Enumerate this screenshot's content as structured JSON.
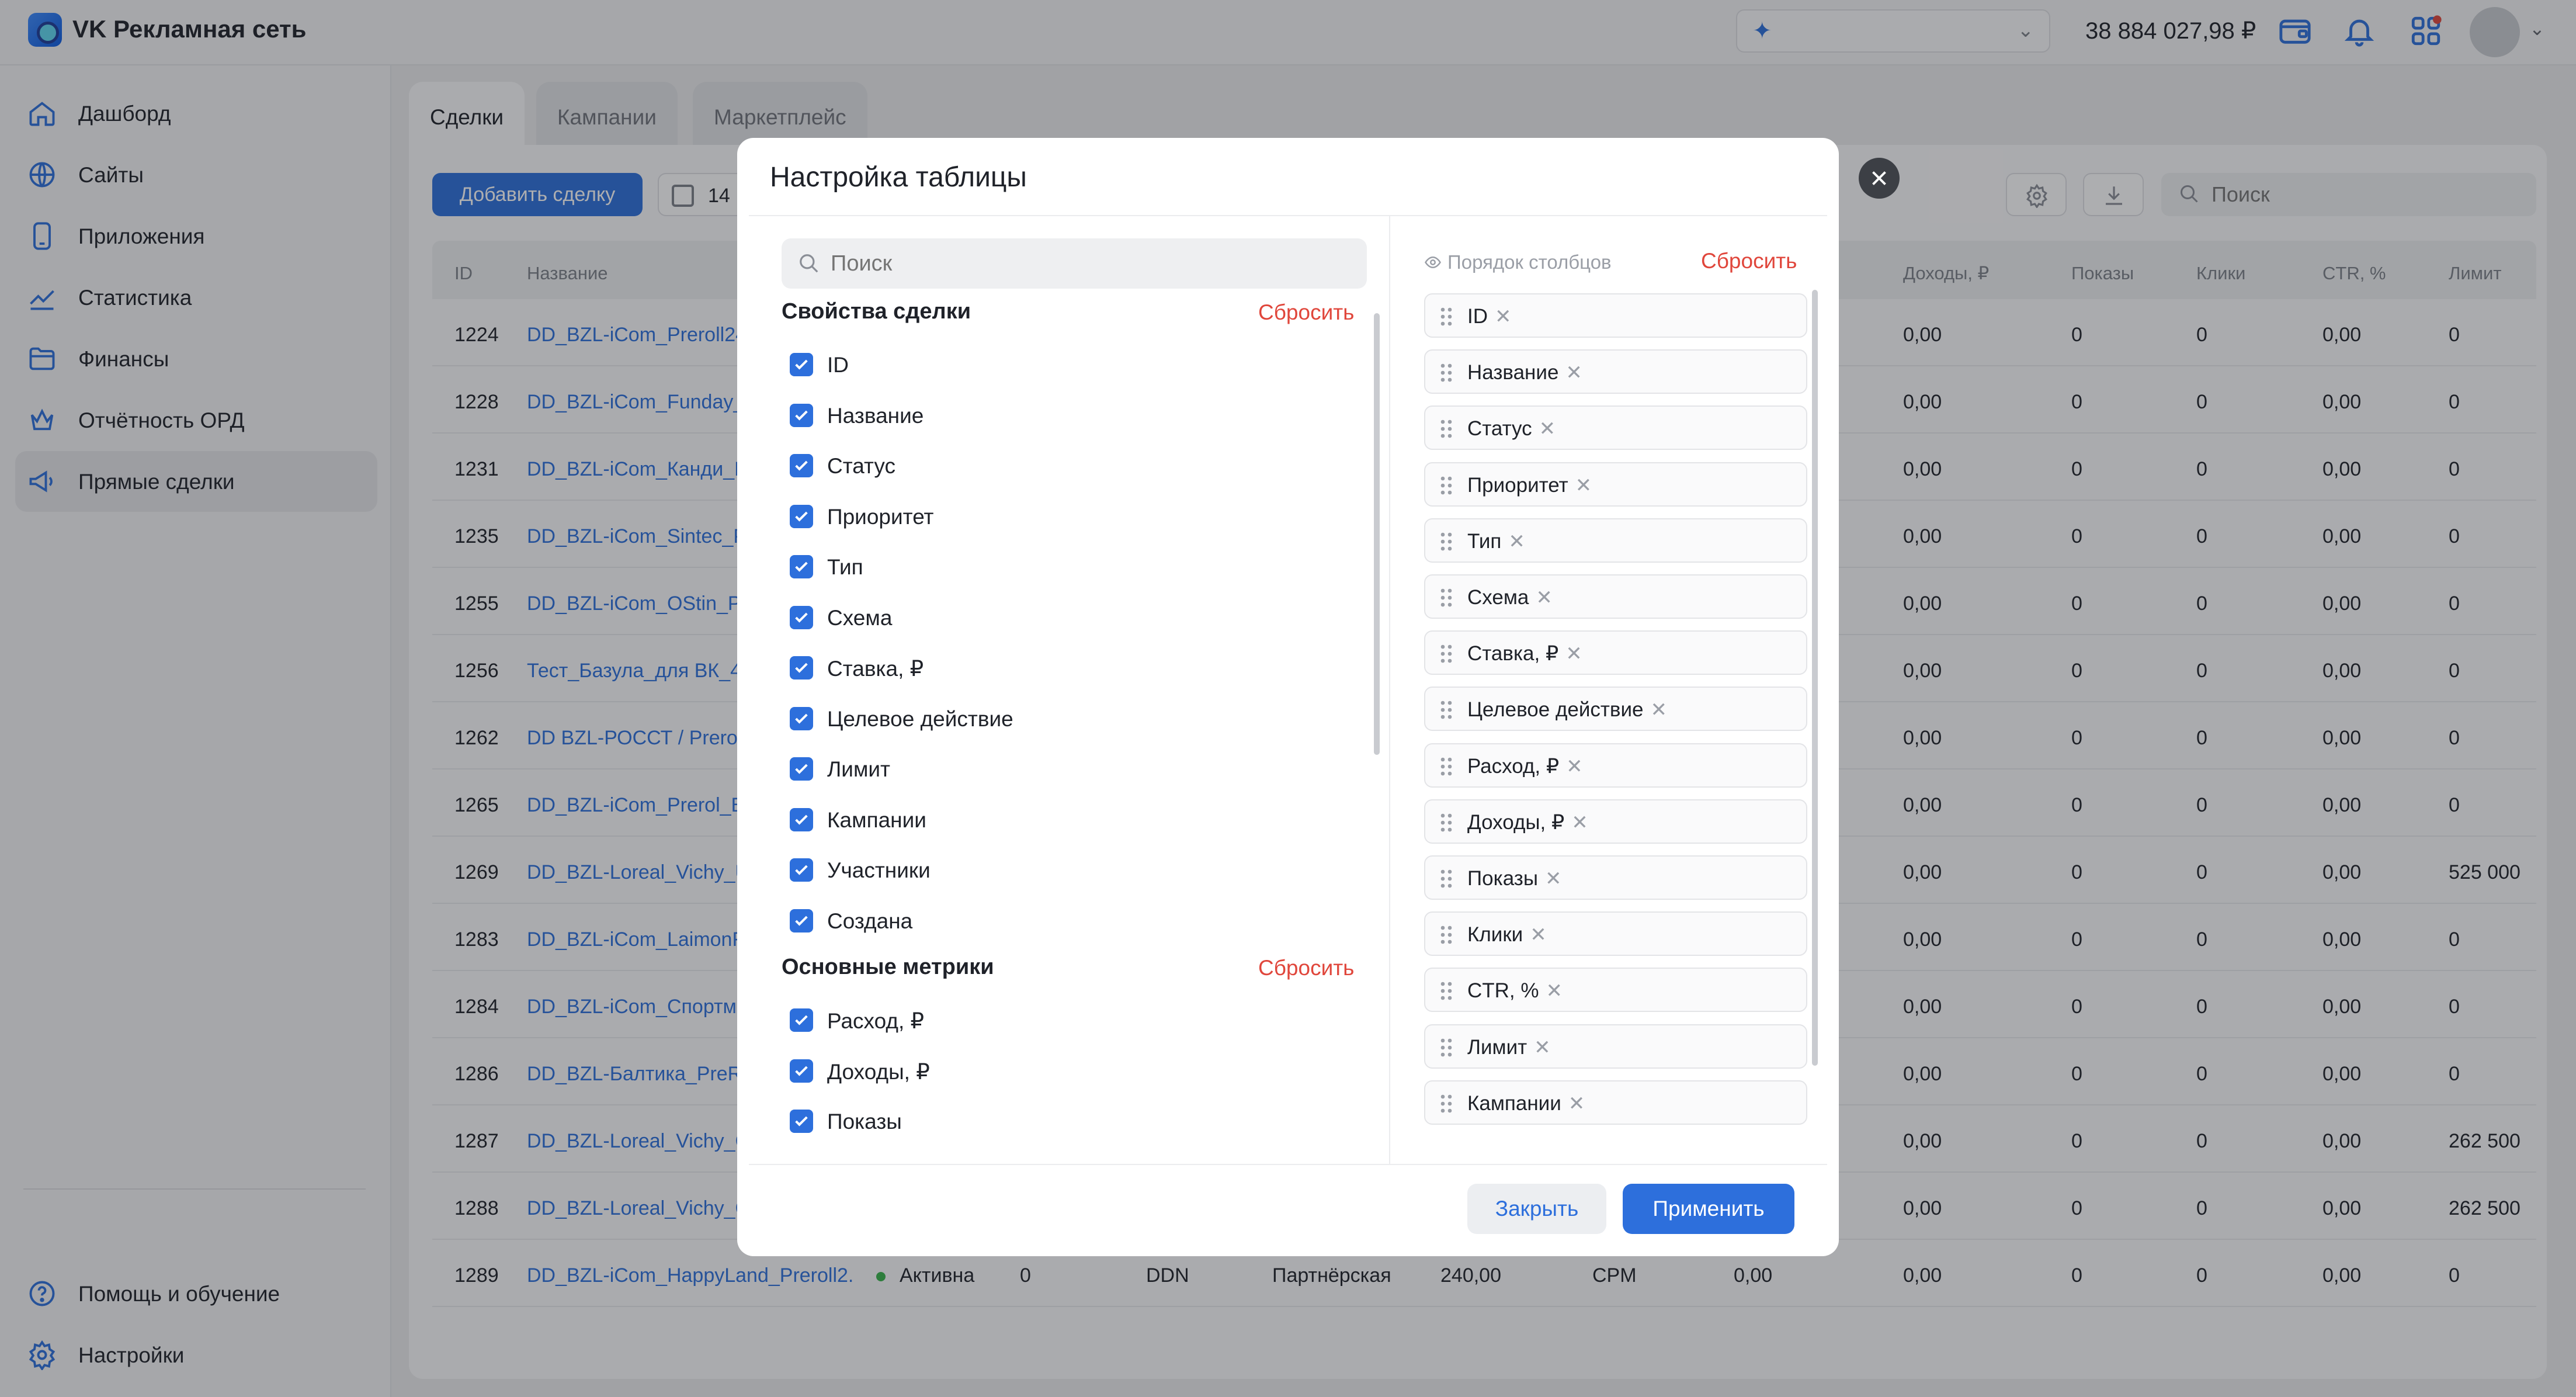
{
  "app": {
    "title": "VK Рекламная сеть",
    "balance": "38 884 027,98 ₽"
  },
  "sidebar": {
    "items": [
      {
        "label": "Дашборд",
        "icon": "home-icon"
      },
      {
        "label": "Сайты",
        "icon": "globe-icon"
      },
      {
        "label": "Приложения",
        "icon": "phone-icon"
      },
      {
        "label": "Статистика",
        "icon": "chart-icon"
      },
      {
        "label": "Финансы",
        "icon": "folder-icon"
      },
      {
        "label": "Отчётность ОРД",
        "icon": "crown-icon"
      },
      {
        "label": "Прямые сделки",
        "icon": "megaphone-icon"
      }
    ],
    "help": "Помощь и обучение",
    "settings": "Настройки"
  },
  "tabs": [
    "Сделки",
    "Кампании",
    "Маркетплейс"
  ],
  "toolbar": {
    "add_deal": "Добавить сделку",
    "date_value": "14",
    "search_placeholder": "Поиск"
  },
  "table": {
    "headers": [
      "ID",
      "Название",
      "Доходы, ₽",
      "Показы",
      "Клики",
      "CTR, %",
      "Лимит"
    ],
    "rows": [
      {
        "id": "1224",
        "name": "DD_BZL-iCom_Preroll24",
        "income": "0,00",
        "views": "0",
        "clicks": "0",
        "ctr": "0,00",
        "limit": "0"
      },
      {
        "id": "1228",
        "name": "DD_BZL-iCom_Funday_",
        "income": "0,00",
        "views": "0",
        "clicks": "0",
        "ctr": "0,00",
        "limit": "0"
      },
      {
        "id": "1231",
        "name": "DD_BZL-iCom_Канди_Р",
        "income": "0,00",
        "views": "0",
        "clicks": "0",
        "ctr": "0,00",
        "limit": "0"
      },
      {
        "id": "1235",
        "name": "DD_BZL-iCom_Sintec_P",
        "income": "0,00",
        "views": "0",
        "clicks": "0",
        "ctr": "0,00",
        "limit": "0"
      },
      {
        "id": "1255",
        "name": "DD_BZL-iCom_OStin_Pr",
        "income": "0,00",
        "views": "0",
        "clicks": "0",
        "ctr": "0,00",
        "limit": "0"
      },
      {
        "id": "1256",
        "name": "Тест_Базула_для ВК_4",
        "income": "0,00",
        "views": "0",
        "clicks": "0",
        "ctr": "0,00",
        "limit": "0"
      },
      {
        "id": "1262",
        "name": "DD BZL-РОССТ / Preroll",
        "income": "0,00",
        "views": "0",
        "clicks": "0",
        "ctr": "0,00",
        "limit": "0"
      },
      {
        "id": "1265",
        "name": "DD_BZL-iCom_Prerol_Б",
        "income": "0,00",
        "views": "0",
        "clicks": "0",
        "ctr": "0,00",
        "limit": "0"
      },
      {
        "id": "1269",
        "name": "DD_BZL-Loreal_Vichy_U",
        "income": "0,00",
        "views": "0",
        "clicks": "0",
        "ctr": "0,00",
        "limit": "525 000"
      },
      {
        "id": "1283",
        "name": "DD_BZL-iCom_LaimonFr",
        "income": "0,00",
        "views": "0",
        "clicks": "0",
        "ctr": "0,00",
        "limit": "0"
      },
      {
        "id": "1284",
        "name": "DD_BZL-iCom_Спортма",
        "income": "0,00",
        "views": "0",
        "clicks": "0",
        "ctr": "0,00",
        "limit": "0"
      },
      {
        "id": "1286",
        "name": "DD_BZL-Балтика_PreRo",
        "income": "0,00",
        "views": "0",
        "clicks": "0",
        "ctr": "0,00",
        "limit": "0"
      },
      {
        "id": "1287",
        "name": "DD_BZL-Loreal_Vichy_C",
        "income": "0,00",
        "views": "0",
        "clicks": "0",
        "ctr": "0,00",
        "limit": "262 500"
      },
      {
        "id": "1288",
        "name": "DD_BZL-Loreal_Vichy_C",
        "income": "0,00",
        "views": "0",
        "clicks": "0",
        "ctr": "0,00",
        "limit": "262 500"
      }
    ],
    "last_row": {
      "id": "1289",
      "name": "DD_BZL-iCom_HappyLand_Preroll2...",
      "status": "Активна",
      "priority": "0",
      "type": "DDN",
      "scheme": "Партнёрская",
      "rate": "240,00",
      "action": "CPM",
      "spend": "0,00",
      "income": "0,00",
      "views": "0",
      "clicks": "0",
      "ctr": "0,00",
      "limit": "0"
    }
  },
  "modal": {
    "title": "Настройка таблицы",
    "search_placeholder": "Поиск",
    "groups": [
      {
        "title": "Свойства сделки",
        "reset": "Сбросить",
        "items": [
          "ID",
          "Название",
          "Статус",
          "Приоритет",
          "Тип",
          "Схема",
          "Ставка, ₽",
          "Целевое действие",
          "Лимит",
          "Кампании",
          "Участники",
          "Создана"
        ]
      },
      {
        "title": "Основные метрики",
        "reset": "Сбросить",
        "items": [
          "Расход, ₽",
          "Доходы, ₽",
          "Показы"
        ]
      }
    ],
    "order_title": "Порядок столбцов",
    "order_reset": "Сбросить",
    "order": [
      "ID",
      "Название",
      "Статус",
      "Приоритет",
      "Тип",
      "Схема",
      "Ставка, ₽",
      "Целевое действие",
      "Расход, ₽",
      "Доходы, ₽",
      "Показы",
      "Клики",
      "CTR, %",
      "Лимит",
      "Кампании"
    ],
    "close_label": "Закрыть",
    "apply_label": "Применить"
  },
  "colors": {
    "accent": "#2d6fdc",
    "danger": "#e0463b",
    "status_active": "#38b24a"
  }
}
